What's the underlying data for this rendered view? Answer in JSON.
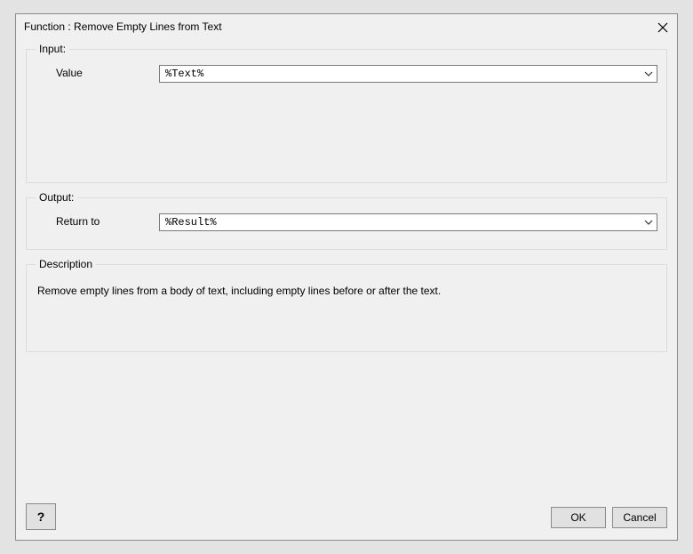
{
  "window": {
    "title": "Function : Remove Empty Lines from Text"
  },
  "groups": {
    "input": {
      "legend": "Input:"
    },
    "output": {
      "legend": "Output:"
    },
    "desc": {
      "legend": "Description"
    }
  },
  "input": {
    "value_label": "Value",
    "value_content": "%Text%"
  },
  "output": {
    "return_label": "Return to",
    "return_content": "%Result%"
  },
  "description": {
    "text": "Remove empty lines from a body of text, including empty lines before or after the text."
  },
  "buttons": {
    "help": "?",
    "ok": "OK",
    "cancel": "Cancel"
  }
}
